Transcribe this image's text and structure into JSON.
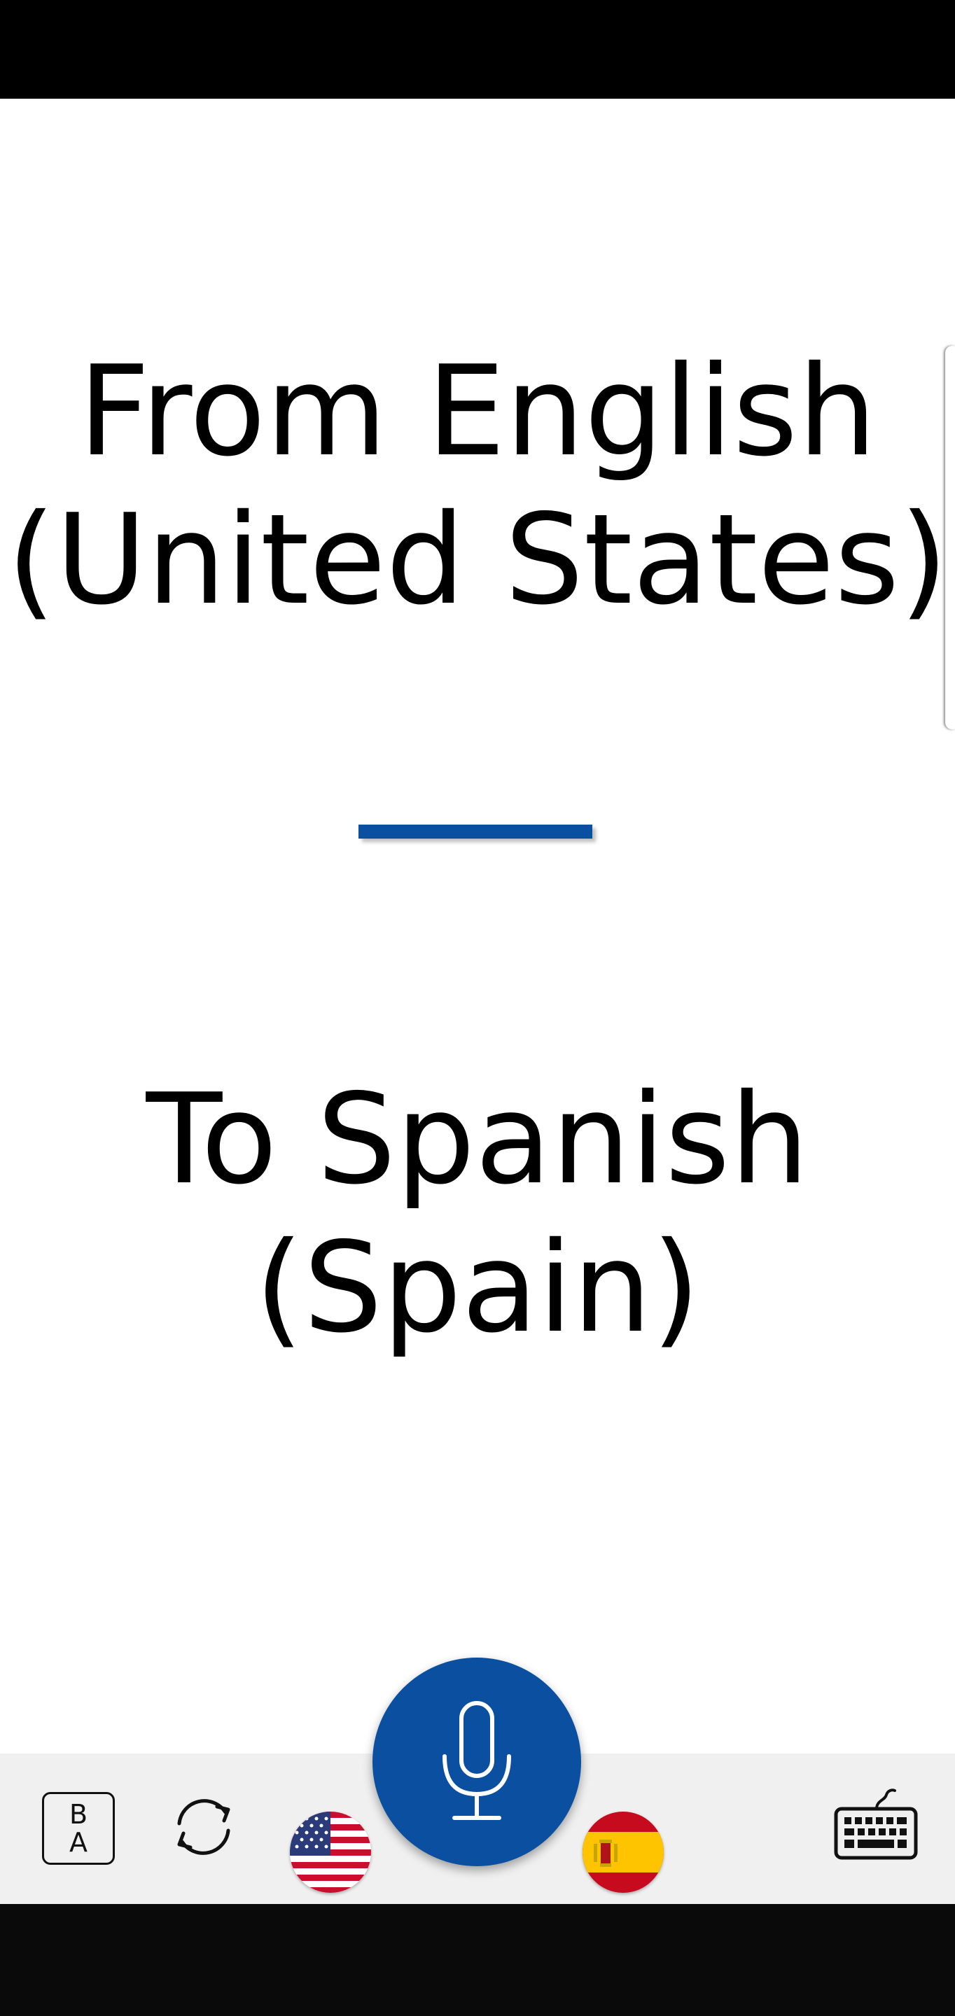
{
  "translation": {
    "from_label": "From English (United States)",
    "to_label": "To Spanish (Spain)"
  },
  "toolbar": {
    "ab_toggle": {
      "top_letter": "B",
      "bottom_letter": "A",
      "icon": "text-direction-icon"
    },
    "swap": {
      "icon": "swap-languages-icon"
    },
    "source_flag": {
      "icon": "us-flag-icon"
    },
    "microphone": {
      "icon": "microphone-icon"
    },
    "target_flag": {
      "icon": "spain-flag-icon"
    },
    "keyboard": {
      "icon": "keyboard-icon"
    }
  },
  "colors": {
    "accent": "#0a4fa0",
    "toolbar_bg": "#f0f0f0",
    "text": "#000000"
  }
}
